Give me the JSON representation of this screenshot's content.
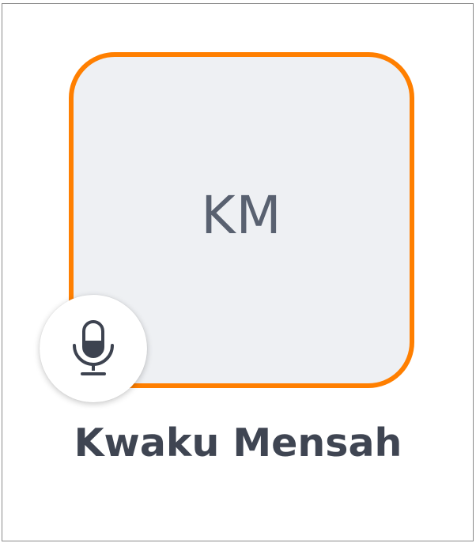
{
  "participant": {
    "initials": "KM",
    "name": "Kwaku Mensah",
    "mic_icon": "microphone-icon",
    "active_speaker_color": "#ff7f00",
    "tile_background": "#eef0f3"
  }
}
